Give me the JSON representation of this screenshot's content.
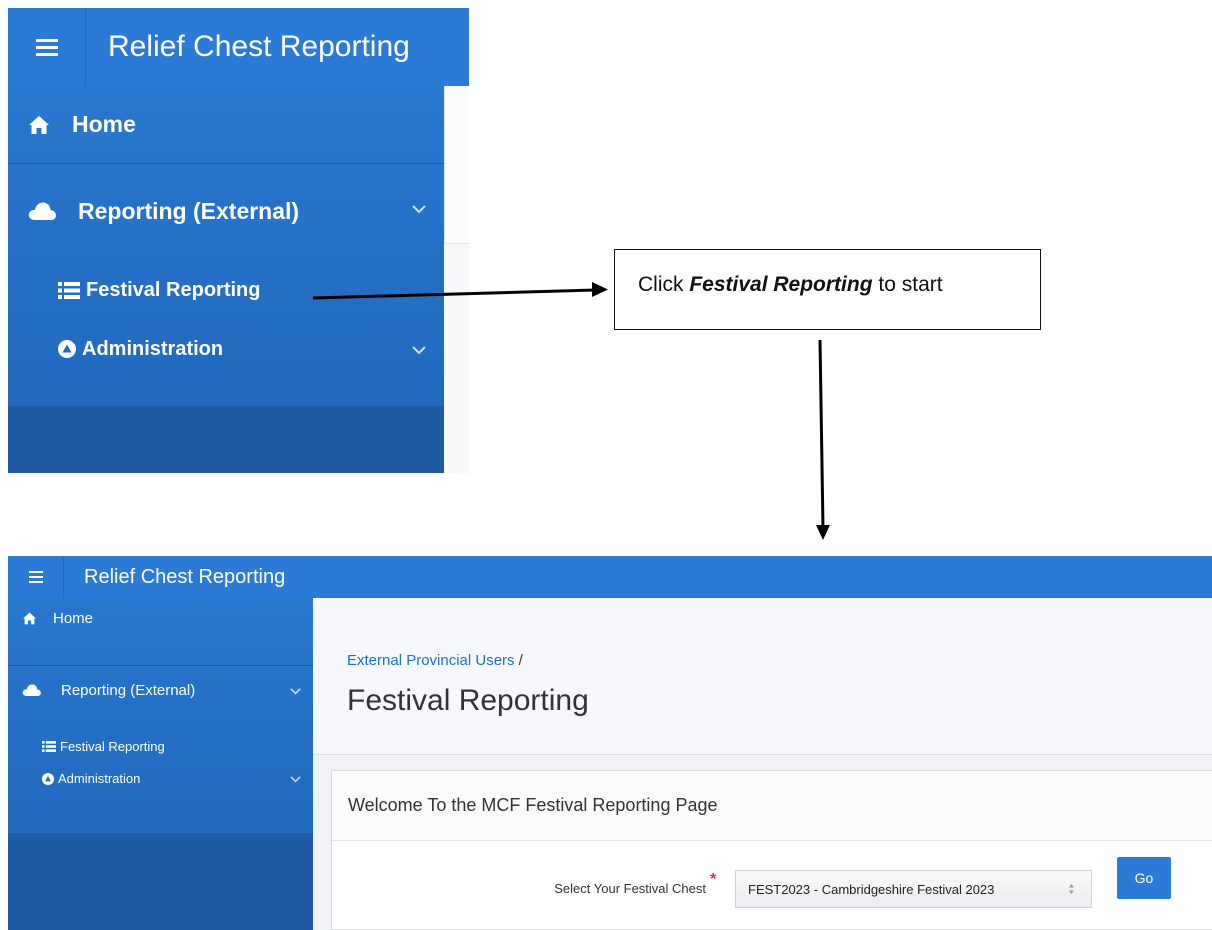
{
  "zoomed_window": {
    "app_title": "Relief Chest Reporting",
    "nav": {
      "home": "Home",
      "reporting": "Reporting (External)",
      "festival_reporting": "Festival Reporting",
      "administration": "Administration"
    }
  },
  "callout": {
    "prefix": "Click ",
    "emphasis": "Festival Reporting",
    "suffix": " to start"
  },
  "app": {
    "app_title": "Relief Chest Reporting",
    "nav": {
      "home": "Home",
      "reporting": "Reporting (External)",
      "festival_reporting": "Festival Reporting",
      "administration": "Administration"
    },
    "breadcrumb": "External Provincial Users",
    "breadcrumb_separator": "/",
    "page_title": "Festival Reporting",
    "region_title": "Welcome To the MCF Festival Reporting Page",
    "form": {
      "select_label": "Select Your Festival Chest",
      "required_marker": "*",
      "selected_value": "FEST2023 - Cambridgeshire Festival 2023",
      "go_label": "Go"
    }
  },
  "icons": {
    "home": "home-icon",
    "reporting": "cloud-icon",
    "festival_reporting": "list-icon",
    "administration": "circle-triangle-icon",
    "menu": "hamburger-icon",
    "expand": "chevron-down-icon"
  },
  "colors": {
    "brand_blue": "#2b7bd6",
    "sidebar_blue": "#2169bf",
    "sidebar_dark": "#1e5ba3",
    "link_blue": "#1e6fd0",
    "required_red": "#e0322b"
  }
}
